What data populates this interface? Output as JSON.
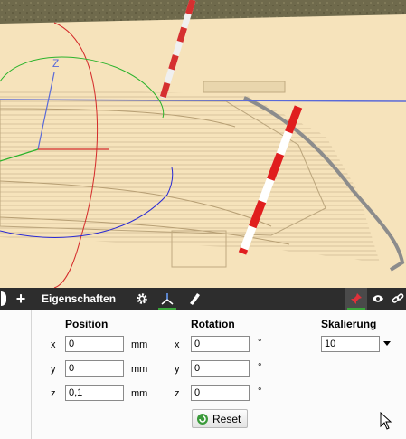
{
  "toolbar": {
    "add_label": "+",
    "title": "Eigenschaften"
  },
  "properties": {
    "position": {
      "header": "Position",
      "rows": [
        {
          "axis": "x",
          "value": "0",
          "unit": "mm"
        },
        {
          "axis": "y",
          "value": "0",
          "unit": "mm"
        },
        {
          "axis": "z",
          "value": "0,1",
          "unit": "mm"
        }
      ]
    },
    "rotation": {
      "header": "Rotation",
      "rows": [
        {
          "axis": "x",
          "value": "0",
          "unit": "°"
        },
        {
          "axis": "y",
          "value": "0",
          "unit": "°"
        },
        {
          "axis": "z",
          "value": "0",
          "unit": "°"
        }
      ]
    },
    "scale": {
      "header": "Skalierung",
      "value": "10"
    },
    "reset_label": "Reset"
  },
  "gizmo": {
    "z_label": "Z"
  },
  "colors": {
    "toolbar_bg": "#2d2d2d",
    "active_green": "#3aa53a",
    "pin_active_bg": "#4a4a4a",
    "ground": "#f6e3bb"
  }
}
